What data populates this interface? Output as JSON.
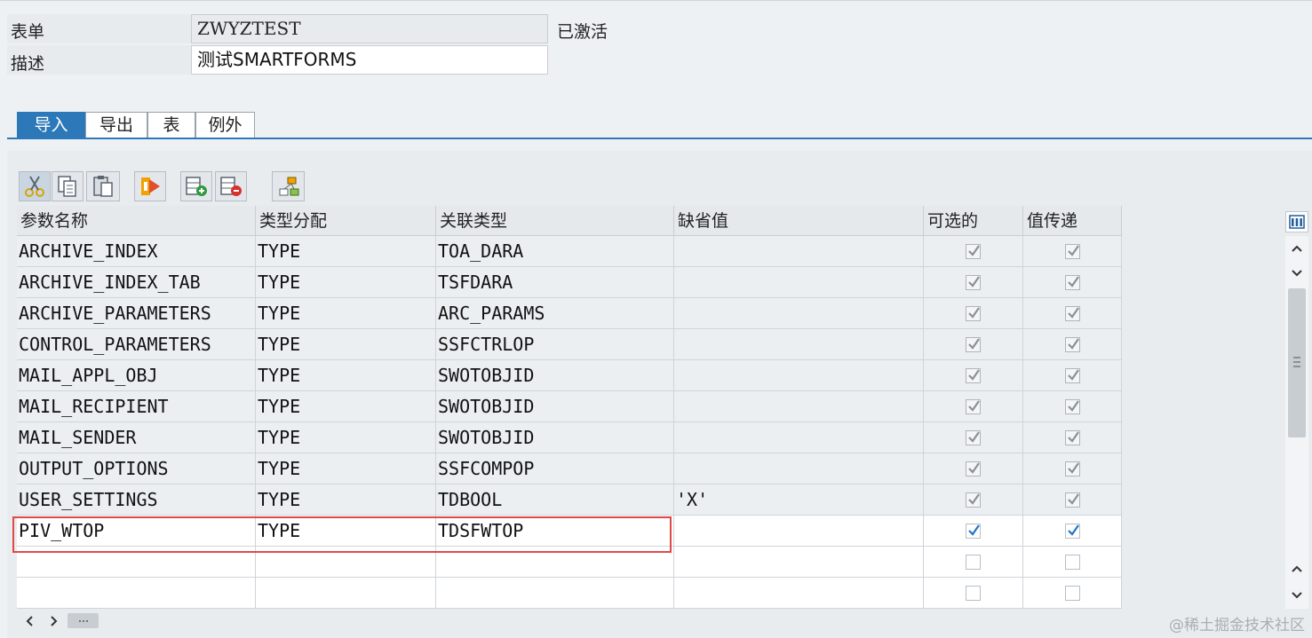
{
  "form": {
    "form_label": "表单",
    "form_value": "ZWYZTEST",
    "status": "已激活",
    "desc_label": "描述",
    "desc_value": "测试SMARTFORMS"
  },
  "tabs": [
    {
      "label": "导入",
      "active": true
    },
    {
      "label": "导出",
      "active": false
    },
    {
      "label": "表",
      "active": false
    },
    {
      "label": "例外",
      "active": false
    }
  ],
  "toolbar": {
    "icons": [
      "cut-icon",
      "copy-icon",
      "paste-icon",
      "move-icon",
      "insert-row-icon",
      "delete-row-icon",
      "hierarchy-icon"
    ]
  },
  "table": {
    "columns": [
      "参数名称",
      "类型分配",
      "关联类型",
      "缺省值",
      "可选的",
      "值传递"
    ],
    "rows": [
      {
        "name": "ARCHIVE_INDEX",
        "assign": "TYPE",
        "type": "TOA_DARA",
        "default": "",
        "optional": true,
        "by_value": true
      },
      {
        "name": "ARCHIVE_INDEX_TAB",
        "assign": "TYPE",
        "type": "TSFDARA",
        "default": "",
        "optional": true,
        "by_value": true
      },
      {
        "name": "ARCHIVE_PARAMETERS",
        "assign": "TYPE",
        "type": "ARC_PARAMS",
        "default": "",
        "optional": true,
        "by_value": true
      },
      {
        "name": "CONTROL_PARAMETERS",
        "assign": "TYPE",
        "type": "SSFCTRLOP",
        "default": "",
        "optional": true,
        "by_value": true
      },
      {
        "name": "MAIL_APPL_OBJ",
        "assign": "TYPE",
        "type": "SWOTOBJID",
        "default": "",
        "optional": true,
        "by_value": true
      },
      {
        "name": "MAIL_RECIPIENT",
        "assign": "TYPE",
        "type": "SWOTOBJID",
        "default": "",
        "optional": true,
        "by_value": true
      },
      {
        "name": "MAIL_SENDER",
        "assign": "TYPE",
        "type": "SWOTOBJID",
        "default": "",
        "optional": true,
        "by_value": true
      },
      {
        "name": "OUTPUT_OPTIONS",
        "assign": "TYPE",
        "type": "SSFCOMPOP",
        "default": "",
        "optional": true,
        "by_value": true
      },
      {
        "name": "USER_SETTINGS",
        "assign": "TYPE",
        "type": "TDBOOL",
        "default": "'X'",
        "optional": true,
        "by_value": true
      },
      {
        "name": "PIV_WTOP",
        "assign": "TYPE",
        "type": "TDSFWTOP",
        "default": "",
        "optional": true,
        "by_value": true,
        "editable": true
      },
      {
        "name": "",
        "assign": "",
        "type": "",
        "default": "",
        "optional": false,
        "by_value": false,
        "editable": true
      },
      {
        "name": "",
        "assign": "",
        "type": "",
        "default": "",
        "optional": false,
        "by_value": false,
        "editable": true
      }
    ]
  },
  "colors": {
    "accent": "#2c78b8",
    "highlight": "#e04848",
    "check_gray": "#8a9096",
    "check_blue": "#1f76c8"
  },
  "watermark": "@稀土掘金技术社区"
}
